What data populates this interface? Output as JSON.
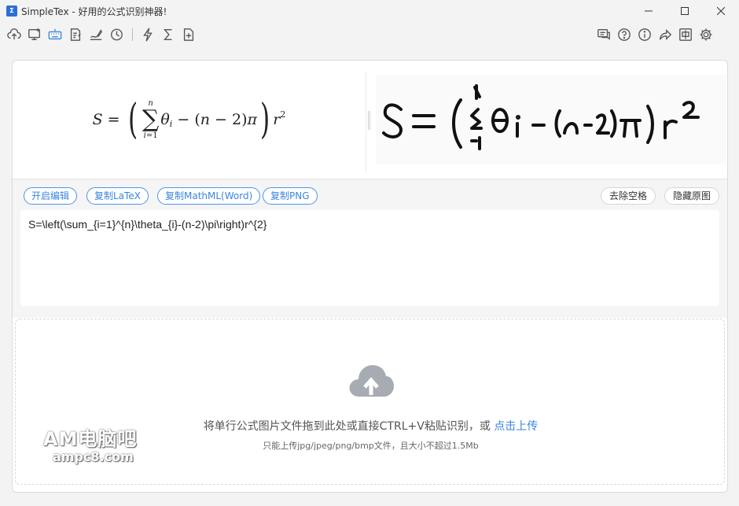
{
  "window": {
    "title": "SimpleTex - 好用的公式识别神器!"
  },
  "toolbar": {
    "left_icons": [
      "cloud-upload-icon",
      "screenshot-icon",
      "keyboard-icon",
      "edit-document-icon",
      "handwriting-icon",
      "history-icon",
      "flash-icon",
      "sigma-icon",
      "add-file-icon"
    ],
    "right_icons": [
      "chat-icon",
      "help-icon",
      "info-icon",
      "share-icon",
      "chinese-language-icon",
      "settings-icon"
    ]
  },
  "actions": {
    "open_editor": "开启编辑",
    "copy_latex": "复制LaTeX",
    "copy_mathml": "复制MathML(Word)",
    "copy_png": "复制PNG",
    "remove_spaces": "去除空格",
    "hide_original": "隐藏原图"
  },
  "latex": {
    "value": "S=\\left(\\sum_{i=1}^{n}\\theta_{i}-(n-2)\\pi\\right)r^{2}"
  },
  "drop_zone": {
    "main_text": "将单行公式图片文件拖到此处或直接CTRL+V粘贴识别，或",
    "upload_link": "点击上传",
    "sub_text": "只能上传jpg/jpeg/png/bmp文件，且大小不超过1.5Mb"
  },
  "watermark": {
    "line1": "AM电脑吧",
    "line2": "ampc8.com"
  },
  "colors": {
    "accent": "#3a86de",
    "cloud": "#a7abb2"
  }
}
